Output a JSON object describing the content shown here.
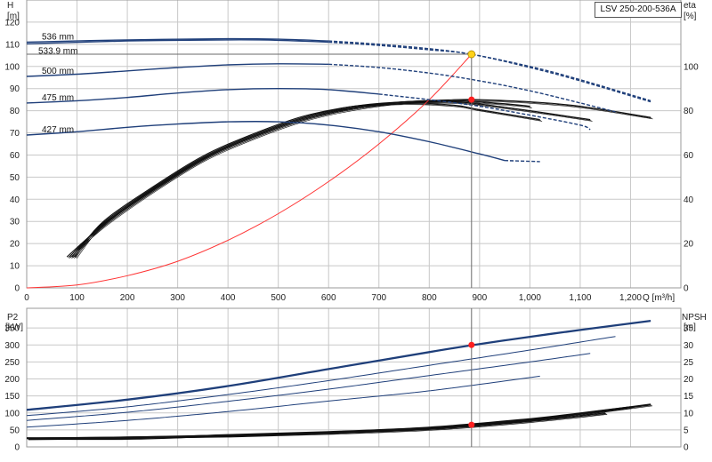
{
  "model": "LSV 250-200-536A",
  "chart_data": [
    {
      "type": "line",
      "xlabel": "Q [m³/h]",
      "ylabel_left": [
        "H",
        "[m]"
      ],
      "ylabel_right": [
        "eta",
        "[%]"
      ],
      "xlim": [
        0,
        1300
      ],
      "ylim_left": [
        0,
        130
      ],
      "ylim_right": [
        0,
        130
      ],
      "x_ticks": [
        "0",
        "100",
        "200",
        "300",
        "400",
        "500",
        "600",
        "700",
        "800",
        "900",
        "1,000",
        "1,100",
        "1,200"
      ],
      "y_left_ticks": [
        "0",
        "10",
        "20",
        "30",
        "40",
        "50",
        "60",
        "70",
        "80",
        "90",
        "100",
        "110",
        "120"
      ],
      "y_right_ticks": [
        "0",
        "20",
        "40",
        "60",
        "80",
        "100"
      ],
      "grid": true,
      "duty_point": {
        "q": 884,
        "head": 105.5,
        "eta": 85
      },
      "head_curves": [
        {
          "name": "536 mm",
          "x": [
            0,
            200,
            400,
            500,
            600,
            700,
            800,
            884,
            1000,
            1100,
            1240
          ],
          "y": [
            111,
            112,
            112.5,
            112.3,
            111.5,
            110,
            108,
            105.5,
            100,
            94,
            84.5
          ],
          "solid_until": 600
        },
        {
          "name": "533.9 mm",
          "x": [
            0,
            200,
            400,
            500,
            600,
            700,
            800,
            884,
            1000,
            1100,
            1240
          ],
          "y": [
            110.2,
            111.5,
            112,
            111.8,
            111,
            109.5,
            107.5,
            105.5,
            99.5,
            93.5,
            84
          ],
          "solid_until": 600
        },
        {
          "name": "500 mm",
          "x": [
            0,
            100,
            200,
            300,
            400,
            500,
            600,
            700,
            800,
            900,
            1000,
            1100,
            1170
          ],
          "y": [
            95.5,
            96.5,
            98,
            99.5,
            100.7,
            101.2,
            101,
            99.5,
            97,
            93.5,
            89,
            83.5,
            79.5
          ],
          "solid_until": 600
        },
        {
          "name": "475 mm",
          "x": [
            0,
            100,
            200,
            300,
            400,
            500,
            600,
            700,
            800,
            900,
            1000,
            1100,
            1120
          ],
          "y": [
            83.5,
            84.5,
            86,
            88,
            89.5,
            90,
            89.5,
            87.5,
            85,
            82,
            78,
            73.5,
            71.5
          ],
          "solid_until": 700
        },
        {
          "name": "427 mm",
          "x": [
            0,
            100,
            200,
            300,
            400,
            500,
            600,
            700,
            800,
            900,
            950,
            1020
          ],
          "y": [
            69,
            70.5,
            72.5,
            74,
            75,
            75,
            73.5,
            70.5,
            66,
            60.5,
            57.5,
            57
          ],
          "solid_until": 950
        }
      ],
      "system_curve": {
        "x": [
          0,
          100,
          200,
          300,
          400,
          500,
          600,
          700,
          800,
          884
        ],
        "y": [
          0,
          1.3,
          5.5,
          12,
          21.5,
          33.5,
          48,
          65,
          85,
          105.5
        ]
      },
      "eta_curves": [
        {
          "x": [
            80,
            150,
            250,
            350,
            450,
            550,
            650,
            750,
            850,
            900,
            1000,
            1100,
            1240
          ],
          "y": [
            14,
            28,
            44,
            58,
            68,
            76,
            81,
            84,
            85,
            85,
            84,
            82,
            77
          ]
        },
        {
          "x": [
            85,
            150,
            250,
            350,
            450,
            550,
            650,
            750,
            850,
            900,
            1000,
            1100,
            1170
          ],
          "y": [
            14,
            28.5,
            44.5,
            58.5,
            68.5,
            76.5,
            81.5,
            84,
            84.5,
            84,
            82,
            78
          ]
        },
        {
          "x": [
            90,
            150,
            250,
            350,
            450,
            550,
            650,
            750,
            850,
            900,
            1000,
            1120
          ],
          "y": [
            14,
            29,
            45,
            59,
            69,
            77,
            82,
            84,
            84,
            83,
            80,
            76
          ]
        },
        {
          "x": [
            95,
            150,
            250,
            350,
            450,
            550,
            650,
            750,
            850,
            900,
            1020
          ],
          "y": [
            14,
            29.5,
            45.5,
            59.5,
            69.5,
            77.5,
            82,
            83.5,
            82.5,
            80.5,
            76
          ]
        }
      ]
    },
    {
      "type": "line",
      "xlim": [
        0,
        1300
      ],
      "ylabel_left": [
        "P2",
        "[kW]"
      ],
      "ylabel_right": [
        "NPSH",
        "[m]"
      ],
      "ylim_left": [
        0,
        400
      ],
      "ylim_right": [
        0,
        40
      ],
      "y_left_ticks": [
        "0",
        "50",
        "100",
        "150",
        "200",
        "250",
        "300",
        "350"
      ],
      "y_right_ticks": [
        "0",
        "5",
        "10",
        "15",
        "20",
        "25",
        "30",
        "35"
      ],
      "grid": true,
      "duty_point": {
        "q": 884,
        "p2": 300,
        "npsh": 6.5
      },
      "power_curves": [
        {
          "name": "536 mm",
          "x": [
            0,
            200,
            400,
            600,
            800,
            884,
            1000,
            1100,
            1240
          ],
          "y": [
            110,
            140,
            180,
            230,
            280,
            300,
            325,
            345,
            372
          ]
        },
        {
          "name": "533.9 mm",
          "x": [
            0,
            200,
            400,
            600,
            800,
            884,
            1000,
            1100,
            1240
          ],
          "y": [
            108,
            138,
            178,
            228,
            278,
            298,
            323,
            343,
            370
          ]
        },
        {
          "name": "500 mm",
          "x": [
            0,
            200,
            400,
            600,
            800,
            1000,
            1170
          ],
          "y": [
            92,
            118,
            154,
            195,
            240,
            285,
            325
          ]
        },
        {
          "name": "475 mm",
          "x": [
            0,
            200,
            400,
            600,
            800,
            1000,
            1120
          ],
          "y": [
            78,
            102,
            134,
            170,
            210,
            250,
            275
          ]
        },
        {
          "name": "427 mm",
          "x": [
            0,
            200,
            400,
            600,
            800,
            1020
          ],
          "y": [
            58,
            78,
            104,
            135,
            165,
            208
          ]
        }
      ],
      "npsh_curves": [
        {
          "x": [
            0,
            200,
            400,
            600,
            800,
            884,
            1000,
            1100,
            1240
          ],
          "y": [
            2.5,
            2.8,
            3.4,
            4.3,
            5.6,
            6.5,
            8,
            9.8,
            12.5
          ]
        },
        {
          "x": [
            0,
            200,
            400,
            600,
            800,
            1000,
            1100,
            1200
          ],
          "y": [
            2.7,
            2.6,
            3.6,
            4.5,
            5.8,
            8.3,
            10,
            11.8
          ]
        },
        {
          "x": [
            0,
            200,
            400,
            600,
            800,
            1000,
            1150
          ],
          "y": [
            2.6,
            2.9,
            3.3,
            4.1,
            5.3,
            7.6,
            10
          ]
        }
      ]
    }
  ],
  "colors": {
    "head": "#1f3f7a",
    "system": "#ff3333",
    "eta": "#111111",
    "grid": "#c8c8c8",
    "marker_red": "#ff2020",
    "marker_yellow": "#ffd21a",
    "duty_line": "#6a6a6a"
  }
}
